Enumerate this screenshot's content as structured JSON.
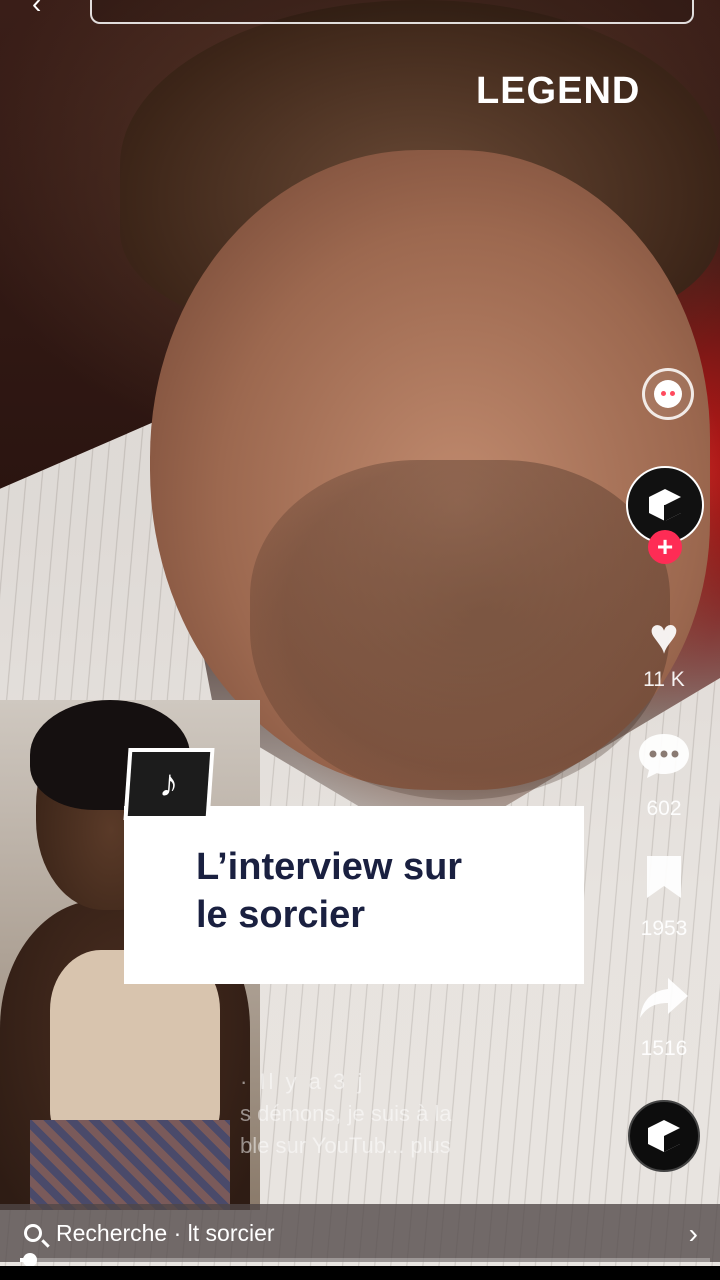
{
  "top": {
    "search_placeholder": ""
  },
  "watermark": "LEGEND",
  "actions": {
    "likes": "11 K",
    "comments": "602",
    "saves": "1953",
    "shares": "1516"
  },
  "title_card": {
    "text": "L’interview sur\nle sorcier"
  },
  "caption": {
    "meta": "· Il y a 3 j",
    "line1": "s démons, je suis à la",
    "line2": "ble sur YouTub... plus"
  },
  "bottom_search": {
    "label": "Recherche · lt sorcier"
  },
  "progress": {
    "value": 0.015
  }
}
